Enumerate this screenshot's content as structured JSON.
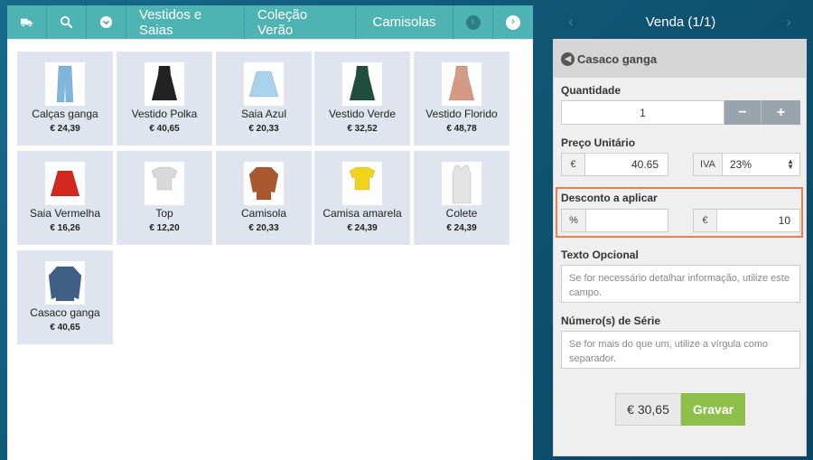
{
  "toolbar": {
    "icons": [
      "truck-icon",
      "search-icon",
      "chevron-down-circle-icon"
    ],
    "categories": [
      "Vestidos e Saias",
      "Coleção Verão",
      "Camisolas"
    ],
    "nav_prev": "‹",
    "nav_next": "›"
  },
  "products": [
    {
      "name": "Calças ganga",
      "price": "€ 24,39",
      "color": "#7fb6dd"
    },
    {
      "name": "Vestido Polka",
      "price": "€ 40,65",
      "color": "#222222"
    },
    {
      "name": "Saia Azul",
      "price": "€ 20,33",
      "color": "#a9d3ec"
    },
    {
      "name": "Vestido Verde",
      "price": "€ 32,52",
      "color": "#1f4e3c"
    },
    {
      "name": "Vestido Florido",
      "price": "€ 48,78",
      "color": "#d59a83"
    },
    {
      "name": "Saia Vermelha",
      "price": "€ 16,26",
      "color": "#d3261f"
    },
    {
      "name": "Top",
      "price": "€ 12,20",
      "color": "#d9d9d9"
    },
    {
      "name": "Camisola",
      "price": "€ 20,33",
      "color": "#a8572f"
    },
    {
      "name": "Camisa amarela",
      "price": "€ 24,39",
      "color": "#f2d21b"
    },
    {
      "name": "Colete",
      "price": "€ 24,39",
      "color": "#e3e3e3"
    },
    {
      "name": "Casaco ganga",
      "price": "€ 40,65",
      "color": "#3f5f86"
    }
  ],
  "sale": {
    "title": "Venda (1/1)",
    "prev": "‹",
    "next": "›",
    "item_name": "Casaco ganga",
    "quantity_label": "Quantidade",
    "quantity": "1",
    "minus": "−",
    "plus": "+",
    "unit_price_label": "Preço Unitário",
    "currency": "€",
    "unit_price": "40.65",
    "iva_label": "IVA",
    "iva_value": "23%",
    "discount_label": "Desconto a aplicar",
    "percent_symbol": "%",
    "discount_percent": "",
    "discount_value": "10",
    "optional_text_label": "Texto Opcional",
    "optional_text_placeholder": "Se for necessário detalhar informação, utilize este campo.",
    "serial_label": "Número(s) de Série",
    "serial_placeholder": "Se for mais do que um, utilize a vírgula como separador.",
    "total": "€ 30,65",
    "save": "Gravar"
  },
  "colors": {
    "accent": "#4eb3b2",
    "highlight": "#f37b4e",
    "save": "#8dbf4a",
    "tile": "#dfe4ee"
  }
}
